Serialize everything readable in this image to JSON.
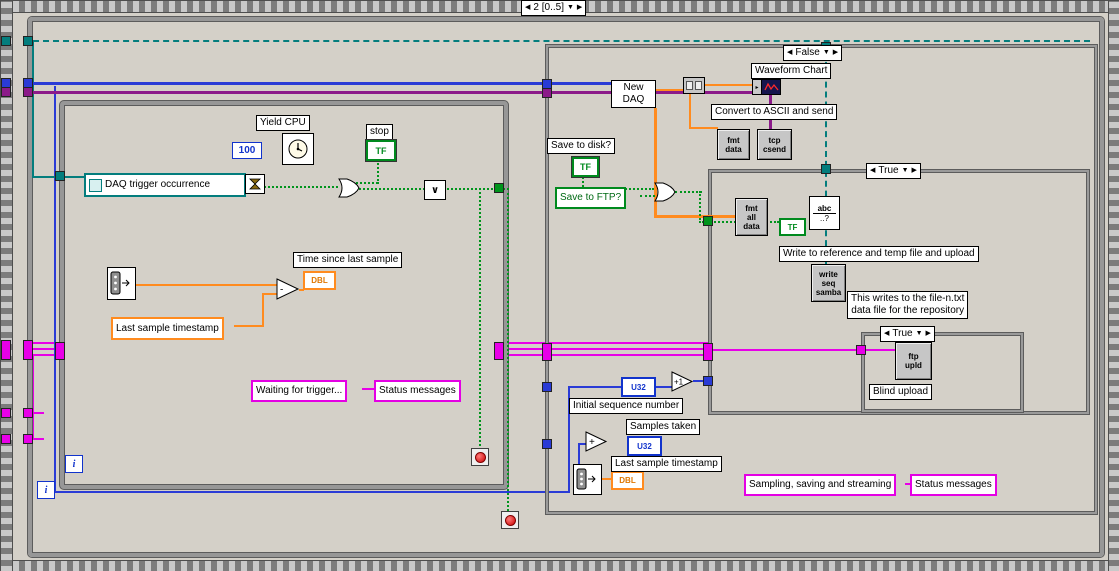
{
  "colors": {
    "background": "#d4d0c8",
    "structure_gray": "#979797",
    "boolean_green": "#008a1e",
    "numeric_blue": "#1133cc",
    "float_orange": "#ff8b1f",
    "string_magenta": "#e400e4",
    "refnum_teal": "#037d7d",
    "tcp_purple": "#8b1a89",
    "node_gray": "#c6c6c6"
  },
  "glyphs": {
    "left_arrow": "◀",
    "right_arrow": "▶",
    "down_arrow": "▼",
    "or": "∨",
    "plus": "+",
    "minus": "-",
    "incr": "+1",
    "terminal_arrow": "▸"
  },
  "sequence": {
    "label": "2 [0..5]"
  },
  "outer_loop": {
    "iteration": "i"
  },
  "inner_loop": {
    "iteration": "i",
    "yield_cpu": "Yield CPU",
    "wait_constant": "100",
    "daq_trigger": "DAQ trigger occurrence",
    "stop_label": "stop",
    "stop_tf": "TF",
    "time_since": "Time since last sample",
    "time_since_type": "DBL",
    "last_sample": "Last sample timestamp",
    "waiting_msg": "Waiting for trigger...",
    "status_label": "Status messages"
  },
  "case_false": {
    "selector": "False",
    "new_daq": "New\nDAQ",
    "waveform_chart": "Waveform Chart",
    "convert_note": "Convert to ASCII and send",
    "fmt_data": "fmt\ndata",
    "tcp_csend": "tcp\ncsend",
    "save_disk_label": "Save to disk?",
    "save_disk_tf": "TF",
    "save_ftp": "Save to FTP?",
    "init_seq_type": "U32",
    "init_seq_label": "Initial sequence number",
    "samples_taken_label": "Samples taken",
    "samples_type": "U32",
    "last_sample_type": "DBL",
    "last_sample_label": "Last sample timestamp",
    "sampling_msg": "Sampling, saving and streaming",
    "status_label": "Status messages"
  },
  "case_true": {
    "selector": "True",
    "fmt_all": "fmt\nall\ndata",
    "tf_const": "TF",
    "match_top": "abc",
    "match_bottom": "..?",
    "write_note": "Write to reference and temp file and upload",
    "write_seq": "write\nseq\nsamba",
    "file_note": "This writes to the file-n.txt\ndata file for the repository"
  },
  "case_inner": {
    "selector": "True",
    "ftp_upld": "ftp\nupld",
    "blind_upload": "Blind upload"
  }
}
